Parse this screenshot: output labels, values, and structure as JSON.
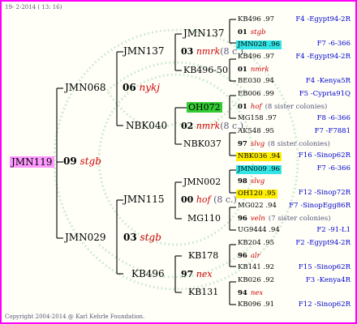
{
  "header": {
    "date": "19- 2-2014 ( 13: 16)"
  },
  "footer": {
    "copyright": "Copyright 2004-2014 @ Karl Kehrle Foundation."
  },
  "root": {
    "name": "JMN119",
    "highlight": "#ff99ff"
  },
  "g1": {
    "num": "09",
    "queen": "stgb",
    "top": {
      "name": "JMN068"
    },
    "bottom": {
      "name": "JMN029"
    }
  },
  "g2": {
    "a": {
      "num": "06",
      "queen": "nykj",
      "top": "JMN137",
      "bottom": "NBK040"
    },
    "b": {
      "num": "03",
      "queen": "stgb",
      "top": "JMN115",
      "bottom": "KB496"
    }
  },
  "g3": {
    "a": {
      "num": "03",
      "queen": "nmrk",
      "note": "(8 c.)",
      "top": "JMN137",
      "bottom": "KB496-50"
    },
    "b": {
      "num": "02",
      "queen": "nmrk",
      "note": "(8 c.)",
      "top": "OH072",
      "bottom": "NBK037"
    },
    "c": {
      "num": "00",
      "queen": "hof",
      "note": "(8 c.)",
      "top": "JMN002",
      "bottom": "MG110"
    },
    "d": {
      "num": "97",
      "queen": "nex",
      "note": "",
      "top": "KB178",
      "bottom": "KB131"
    }
  },
  "g4": [
    {
      "top": "KB496 .97",
      "topnote": "F4 -Egypt94-2R",
      "num": "01",
      "queen": "stgb",
      "bottom": "JMN028 .96",
      "bottomnote": "F7 -6-366"
    },
    {
      "top": "KB496 .97",
      "topnote": "F4 -Egypt94-2R",
      "num": "01",
      "queen": "nmrk",
      "bottom": "BE030 .94",
      "bottomnote": "F4 -Kenya5R"
    },
    {
      "top": "EB006 .99",
      "topnote": "F5 -Cypria91Q",
      "num": "01",
      "queen": "hof",
      "sib": "(8 sister colonies)",
      "bottom": "MG158 .97",
      "bottomnote": "F8 -6-366"
    },
    {
      "top": "AK548 .95",
      "topnote": "F7 -F7881",
      "num": "97",
      "queen": "slvg",
      "sib": "(8 sister colonies)",
      "bottom": "NBK036 .94",
      "bottomnote": "F16 -Sinop62R"
    },
    {
      "top": "JMN009 .96",
      "topnote": "F7 -6-366",
      "num": "98",
      "queen": "slvg",
      "bottom": "OH120 .95",
      "bottomnote": "F12 -Sinop72R"
    },
    {
      "top": "MG022 .94",
      "topnote": "F7 -SinopEgg86R",
      "num": "96",
      "queen": "veln",
      "sib": "(7 sister colonies)",
      "bottom": "UG9444 .94",
      "bottomnote": "F2 -91-L1"
    },
    {
      "top": "KB204 .95",
      "topnote": "F2 -Egypt94-2R",
      "num": "96",
      "queen": "alr",
      "bottom": "KB141 .92",
      "bottomnote": "F15 -Sinop62R"
    },
    {
      "top": "KB026 .92",
      "topnote": "F3 -Kenya4R",
      "num": "94",
      "queen": "nex",
      "bottom": "KB096 .91",
      "bottomnote": "F12 -Sinop62R"
    }
  ],
  "colors": {
    "cyan": "#33e5e5",
    "green": "#33cc33",
    "yellow": "#ffee00",
    "border": "#ff00ff",
    "red": "#cc0000",
    "blue": "#0000cc"
  }
}
